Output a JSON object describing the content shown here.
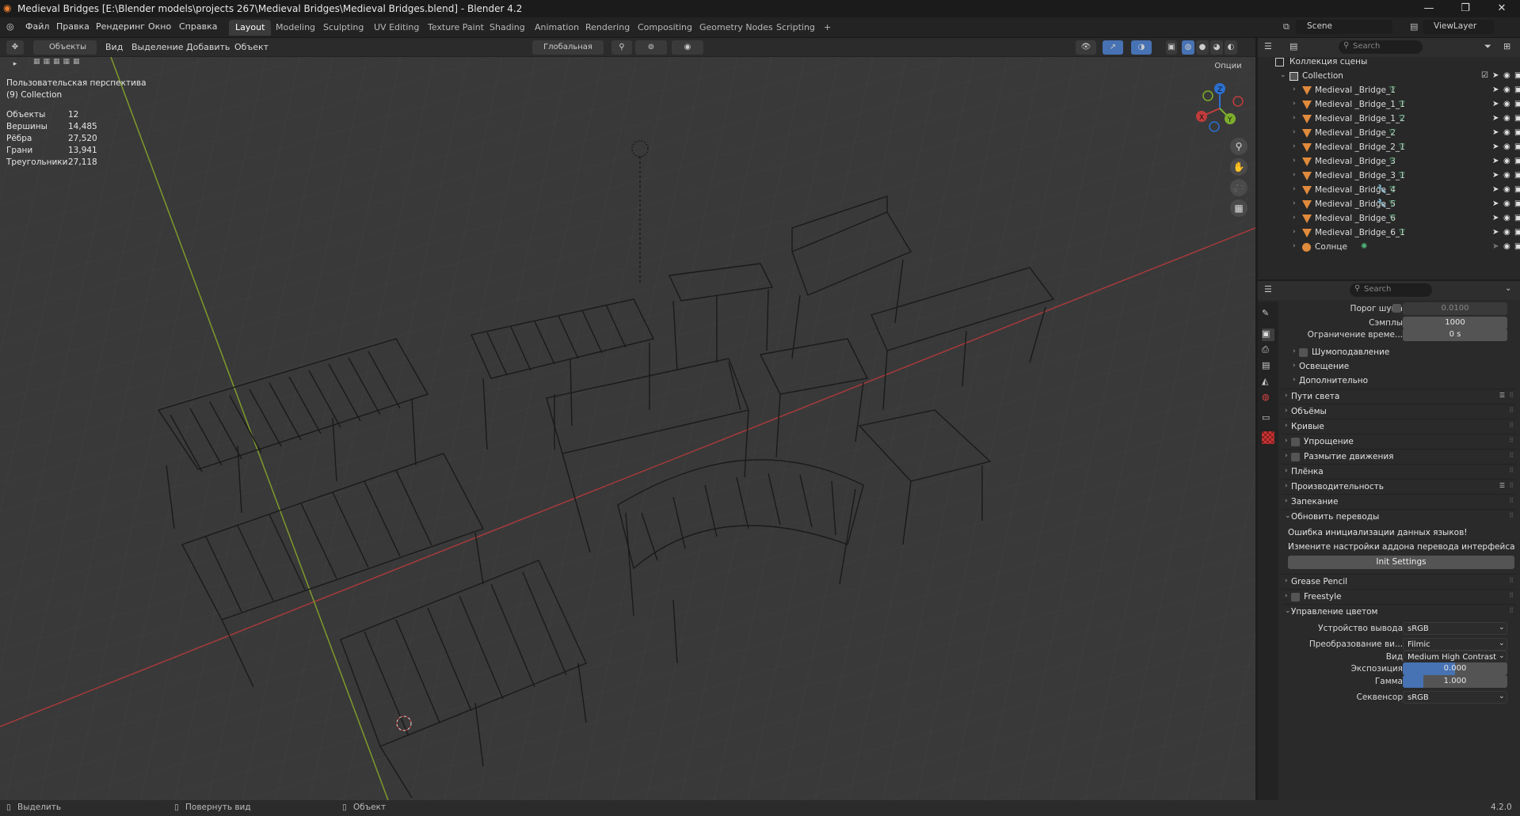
{
  "window": {
    "title": "Medieval Bridges [E:\\Blender models\\projects 267\\Medieval Bridges\\Medieval Bridges.blend] - Blender 4.2",
    "minimize": "—",
    "maximize": "❐",
    "close": "✕"
  },
  "menu": {
    "items": [
      "Файл",
      "Правка",
      "Рендеринг",
      "Окно",
      "Справка"
    ]
  },
  "workspaces": {
    "tabs": [
      "Layout",
      "Modeling",
      "Sculpting",
      "UV Editing",
      "Texture Paint",
      "Shading",
      "Animation",
      "Rendering",
      "Compositing",
      "Geometry Nodes",
      "Scripting"
    ],
    "active": "Layout",
    "add": "+"
  },
  "scene": {
    "name": "Scene",
    "view_layer": "ViewLayer"
  },
  "viewport": {
    "mode": "Объекты",
    "menu": [
      "Вид",
      "Выделение",
      "Добавить",
      "Объект"
    ],
    "orientation": "Глобальная",
    "options": "Опции",
    "view_name": "Пользовательская перспектива",
    "collection": "(9) Collection",
    "stats": [
      {
        "label": "Объекты",
        "value": "12"
      },
      {
        "label": "Вершины",
        "value": "14,485"
      },
      {
        "label": "Рёбра",
        "value": "27,520"
      },
      {
        "label": "Грани",
        "value": "13,941"
      },
      {
        "label": "Треугольники",
        "value": "27,118"
      }
    ],
    "gizmo": {
      "x": "X",
      "y": "Y",
      "z": "Z"
    }
  },
  "outliner": {
    "search_placeholder": "Search",
    "scene_collection": "Коллекция сцены",
    "collection": "Collection",
    "items": [
      {
        "name": "Medieval _Bridge_1",
        "mods": false
      },
      {
        "name": "Medieval _Bridge_1_1",
        "mods": false
      },
      {
        "name": "Medieval _Bridge_1_2",
        "mods": false
      },
      {
        "name": "Medieval _Bridge_2",
        "mods": false
      },
      {
        "name": "Medieval _Bridge_2_1",
        "mods": false
      },
      {
        "name": "Medieval _Bridge_3",
        "mods": false
      },
      {
        "name": "Medieval _Bridge_3_1",
        "mods": false
      },
      {
        "name": "Medieval _Bridge_4",
        "mods": true
      },
      {
        "name": "Medieval _Bridge_5",
        "mods": true
      },
      {
        "name": "Medieval _Bridge_6",
        "mods": false
      },
      {
        "name": "Medieval _Bridge_6_1",
        "mods": false
      },
      {
        "name": "Солнце",
        "mods": false
      }
    ]
  },
  "properties": {
    "search_placeholder": "Search",
    "noise_threshold": {
      "label": "Порог шума",
      "value": "0.0100"
    },
    "samples": {
      "label": "Сэмплы",
      "value": "1000"
    },
    "time_limit": {
      "label": "Ограничение време...",
      "value": "0 s"
    },
    "sub_panels": [
      "Шумоподавление",
      "Освещение",
      "Дополнительно"
    ],
    "panels": [
      {
        "label": "Пути света",
        "checkbox": false
      },
      {
        "label": "Объёмы",
        "checkbox": false
      },
      {
        "label": "Кривые",
        "checkbox": false
      },
      {
        "label": "Упрощение",
        "checkbox": true
      },
      {
        "label": "Размытие движения",
        "checkbox": true
      },
      {
        "label": "Плёнка",
        "checkbox": false
      },
      {
        "label": "Производительность",
        "checkbox": false
      },
      {
        "label": "Запекание",
        "checkbox": false
      }
    ],
    "translation_panel": {
      "label": "Обновить переводы",
      "error": "Ошибка инициализации данных языков!",
      "hint": "Измените настройки аддона перевода интерфейса",
      "button": "Init Settings"
    },
    "grease_pencil": "Grease Pencil",
    "freestyle": "Freestyle",
    "color_management": {
      "label": "Управление цветом",
      "display_device": {
        "label": "Устройство вывода",
        "value": "sRGB"
      },
      "view_transform": {
        "label": "Преобразование ви...",
        "value": "Filmic"
      },
      "look": {
        "label": "Вид",
        "value": "Medium High Contrast"
      },
      "exposure": {
        "label": "Экспозиция",
        "value": "0.000",
        "fill": 0.5
      },
      "gamma": {
        "label": "Гамма",
        "value": "1.000",
        "fill": 0.2
      },
      "sequencer": {
        "label": "Секвенсор",
        "value": "sRGB"
      }
    }
  },
  "statusbar": {
    "select": "Выделить",
    "rotate": "Повернуть вид",
    "object": "Объект",
    "version": "4.2.0"
  },
  "colors": {
    "accent": "#4772b3",
    "x_axis": "#a83a3a",
    "y_axis": "#7f9a2b",
    "mesh_icon": "#e08a3c",
    "mesh_data": "#4fb87a"
  }
}
